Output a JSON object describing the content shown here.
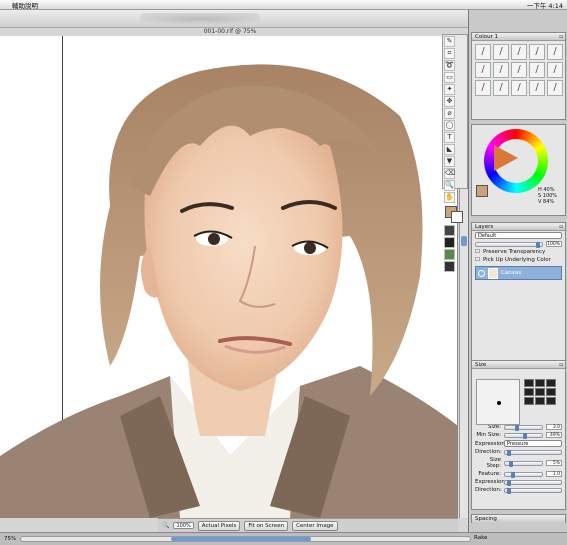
{
  "menubar": {
    "apple": "",
    "help_menu": "輔助說明",
    "clock": "一下午 4:14"
  },
  "propbar": {
    "brush_category": "Blenders",
    "brush_variant": "Just Add Water"
  },
  "document": {
    "title": "001-00.rif @ 75%"
  },
  "canvas_controls": {
    "zoom": "100%",
    "actual_pixels": "Actual Pixels",
    "fit_on_screen": "Fit on Screen",
    "center_image": "Center Image"
  },
  "status": {
    "zoom": "75%"
  },
  "toolbox": {
    "tools": [
      "brush-tool",
      "crop-tool",
      "lasso-tool",
      "rect-select-tool",
      "magic-wand-tool",
      "layer-adjuster-tool",
      "dropper-tool",
      "oval-tool",
      "text-tool",
      "shape-tool",
      "paint-bucket-tool",
      "eraser-tool",
      "magnifier-tool",
      "grabber-tool"
    ],
    "tool_glyphs": [
      "✎",
      "⌗",
      "➰",
      "▭",
      "✦",
      "✥",
      "⌀",
      "◯",
      "T",
      "◣",
      "▼",
      "⌫",
      "🔍",
      "✋"
    ]
  },
  "brush_panel": {
    "title": "Colour 1",
    "brush_glyphs": [
      "/",
      "/",
      "/",
      "/",
      "/",
      "/",
      "/",
      "/",
      "/",
      "/",
      "/",
      "/",
      "/",
      "/",
      "/"
    ]
  },
  "colour_panel": {
    "h": "H 40%",
    "s": "S 100%",
    "v": "V 84%",
    "current_color": "#c9a27e"
  },
  "layers_panel": {
    "title": "Layers",
    "composite": "Default",
    "opacity": "100%",
    "preserve_transparency": "Preserve Transparency",
    "pick_up_color": "Pick Up Underlying Color",
    "layer_name": "Canvas"
  },
  "size_panel": {
    "title": "Size",
    "size_label": "Size:",
    "size_value": "3.0",
    "min_size_label": "Min Size:",
    "min_size_value": "49%",
    "expression_label": "Expression:",
    "expression_value": "Pressure",
    "direction_label": "Direction:",
    "size_step_label": "Size Step:",
    "size_step_value": "5%",
    "feature_label": "Feature:",
    "feature_value": "1.0",
    "expression2_label": "Expression:",
    "direction2_label": "Direction:"
  },
  "spacing_panel": {
    "title": "Spacing"
  },
  "rake_panel": {
    "title": "Rake"
  }
}
